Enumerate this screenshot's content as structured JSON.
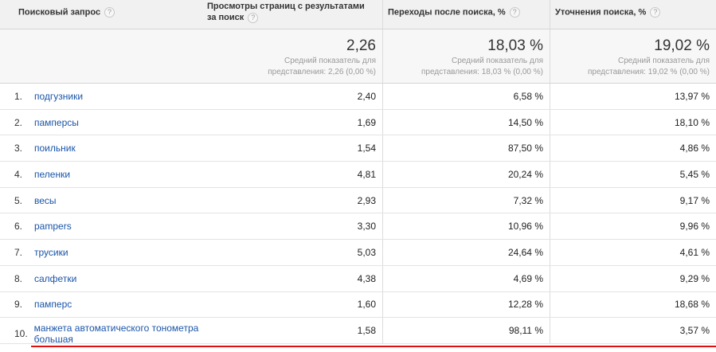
{
  "header": {
    "col_query": "Поисковый запрос",
    "col_views": "Просмотры страниц с результатами за поиск",
    "col_exits": "Переходы после поиска, %",
    "col_refine": "Уточнения поиска, %",
    "help_glyph": "?"
  },
  "summary": {
    "views": {
      "value": "2,26",
      "sub1": "Средний показатель для",
      "sub2": "представления: 2,26 (0,00 %)"
    },
    "exits": {
      "value": "18,03 %",
      "sub1": "Средний показатель для",
      "sub2": "представления: 18,03 % (0,00 %)"
    },
    "refine": {
      "value": "19,02 %",
      "sub1": "Средний показатель для",
      "sub2": "представления: 19,02 % (0,00 %)"
    }
  },
  "rows": [
    {
      "n": "1.",
      "query": "подгузники",
      "views": "2,40",
      "exits": "6,58 %",
      "refine": "13,97 %"
    },
    {
      "n": "2.",
      "query": "памперсы",
      "views": "1,69",
      "exits": "14,50 %",
      "refine": "18,10 %"
    },
    {
      "n": "3.",
      "query": "поильник",
      "views": "1,54",
      "exits": "87,50 %",
      "refine": "4,86 %"
    },
    {
      "n": "4.",
      "query": "пеленки",
      "views": "4,81",
      "exits": "20,24 %",
      "refine": "5,45 %"
    },
    {
      "n": "5.",
      "query": "весы",
      "views": "2,93",
      "exits": "7,32 %",
      "refine": "9,17 %"
    },
    {
      "n": "6.",
      "query": "pampers",
      "views": "3,30",
      "exits": "10,96 %",
      "refine": "9,96 %"
    },
    {
      "n": "7.",
      "query": "трусики",
      "views": "5,03",
      "exits": "24,64 %",
      "refine": "4,61 %"
    },
    {
      "n": "8.",
      "query": "салфетки",
      "views": "4,38",
      "exits": "4,69 %",
      "refine": "9,29 %"
    },
    {
      "n": "9.",
      "query": "памперс",
      "views": "1,60",
      "exits": "12,28 %",
      "refine": "18,68 %"
    },
    {
      "n": "10.",
      "query": "манжета автоматического тонометра большая",
      "views": "1,58",
      "exits": "98,11 %",
      "refine": "3,57 %"
    }
  ],
  "colors": {
    "link": "#1a55a8",
    "highlight_line": "#e01010"
  }
}
